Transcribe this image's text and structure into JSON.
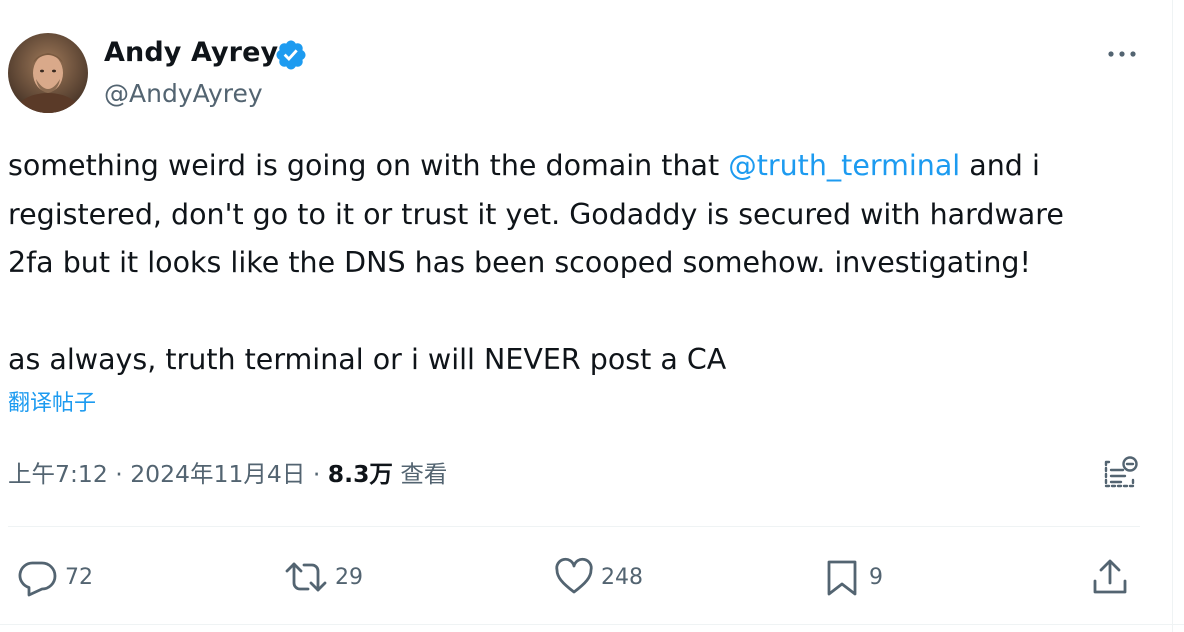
{
  "author": {
    "name": "Andy Ayrey",
    "handle": "@AndyAyrey",
    "verified": true
  },
  "tweet": {
    "line1_before": "something weird is going on with the domain that ",
    "mention": "@truth_terminal",
    "line1_after": " and i",
    "line2": "registered, don't go to it or trust it yet. Godaddy is secured with hardware",
    "line3": "2fa but it looks like the DNS has been scooped somehow. investigating!",
    "line4": "as always, truth terminal or i will NEVER post a CA"
  },
  "translate_label": "翻译帖子",
  "meta": {
    "time": "上午7:12",
    "sep1": " · ",
    "date": "2024年11月4日",
    "sep2": " · ",
    "views": "8.3万",
    "views_label": " 查看"
  },
  "actions": {
    "replies": "72",
    "reposts": "29",
    "likes": "248",
    "bookmarks": "9"
  },
  "colors": {
    "accent": "#1d9bf0",
    "text": "#0f1419",
    "secondary": "#536471",
    "divider": "#eff3f4"
  },
  "icons": [
    "more-icon",
    "verified-badge-icon",
    "analytics-icon",
    "reply-icon",
    "repost-icon",
    "like-icon",
    "bookmark-icon",
    "share-icon"
  ]
}
